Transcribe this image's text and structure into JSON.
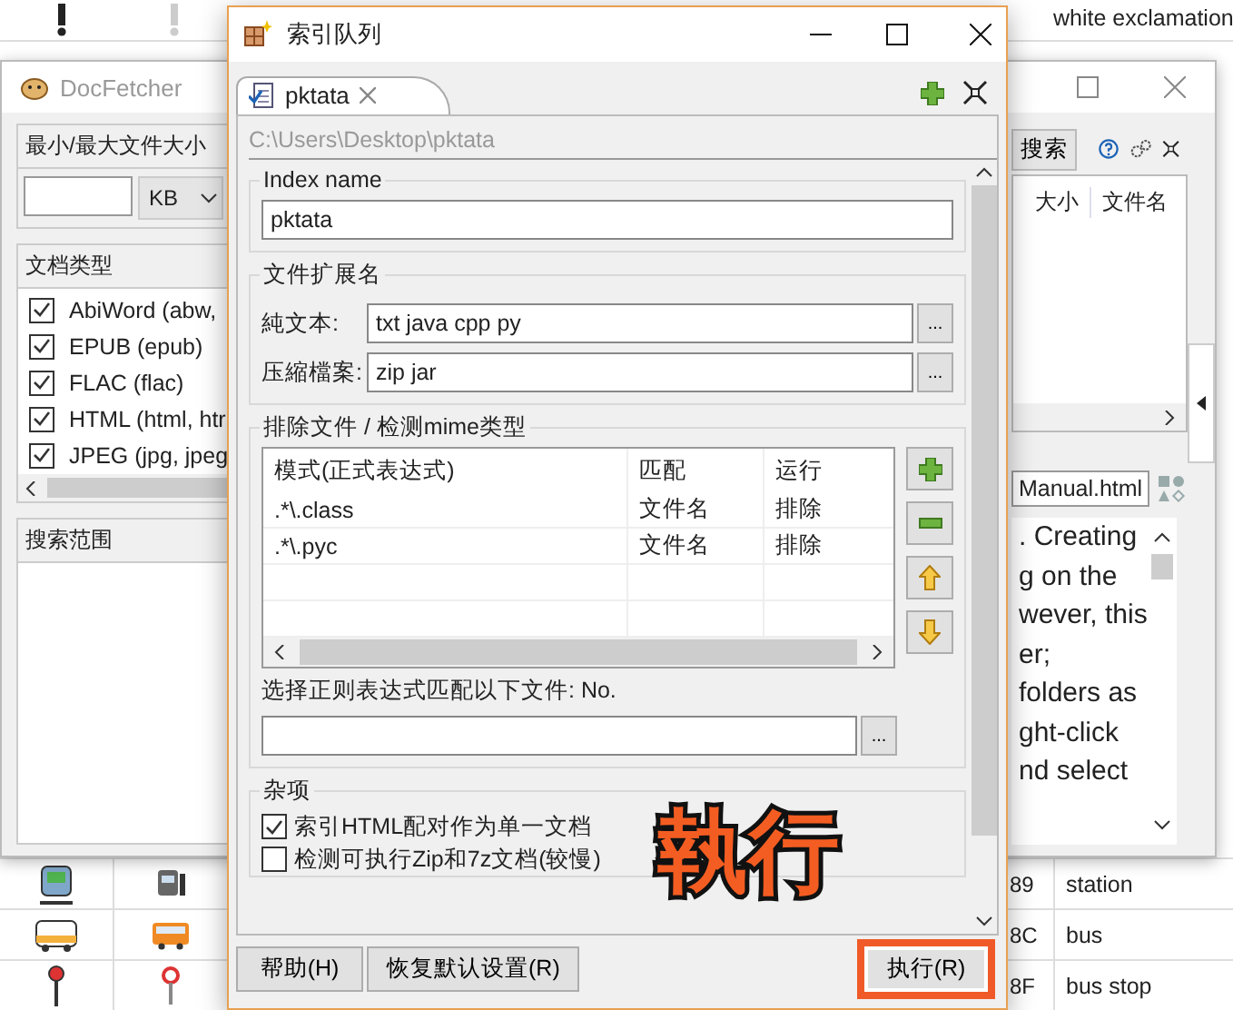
{
  "background_table": {
    "top_row": {
      "name": "white exclamation"
    },
    "rows": [
      {
        "kind": "train",
        "code": "89",
        "name": "station"
      },
      {
        "kind": "bus",
        "code": "8C",
        "name": "bus"
      },
      {
        "kind": "stop",
        "code": "8F",
        "name": "bus stop"
      }
    ]
  },
  "docfetcher": {
    "title": "DocFetcher",
    "size_filter": {
      "title": "最小/最大文件大小",
      "unit": "KB"
    },
    "file_types": {
      "title": "文档类型",
      "items": [
        {
          "label": "AbiWord (abw,",
          "checked": true
        },
        {
          "label": "EPUB (epub)",
          "checked": true
        },
        {
          "label": "FLAC (flac)",
          "checked": true
        },
        {
          "label": "HTML (html, htr",
          "checked": true
        },
        {
          "label": "JPEG (jpg, jpeg",
          "checked": true
        }
      ]
    },
    "search_scope": {
      "title": "搜索范围"
    },
    "search_button": "搜索",
    "result_columns": [
      "大小",
      "文件名"
    ],
    "preview_tab": "Manual.html",
    "preview_lines": [
      ". Creating",
      "g on the",
      "wever, this",
      "er;",
      "folders as",
      "ght-click",
      "nd select"
    ]
  },
  "dialog": {
    "title": "索引队列",
    "tab": {
      "label": "pktata",
      "selected": true
    },
    "path": "C:\\Users\\Desktop\\pktata",
    "index_name": {
      "title": "Index name",
      "value": "pktata"
    },
    "extensions": {
      "title": "文件扩展名",
      "fields": [
        {
          "label": "純文本:",
          "value": "txt java cpp py",
          "browse": "..."
        },
        {
          "label": "压縮檔案:",
          "value": "zip jar",
          "browse": "..."
        }
      ]
    },
    "exclusions": {
      "title": "排除文件 / 检测mime类型",
      "columns": [
        "模式(正式表达式)",
        "匹配",
        "运行"
      ],
      "rows": [
        [
          ".*\\.class",
          "文件名",
          "排除"
        ],
        [
          ".*\\.pyc",
          "文件名",
          "排除"
        ]
      ],
      "hint": "选择正则表达式匹配以下文件: No.",
      "browse": "..."
    },
    "misc": {
      "title": "杂项",
      "options": [
        {
          "label": "索引HTML配对作为单一文档",
          "checked": true
        },
        {
          "label": "检测可执行Zip和7z文档(较慢)",
          "checked": false
        }
      ]
    },
    "buttons": [
      {
        "label": "帮助(H)",
        "highlighted": false
      },
      {
        "label": "恢复默认设置(R)",
        "highlighted": false
      },
      {
        "label": "执行(R)",
        "highlighted": true
      }
    ]
  },
  "annotation": "執行"
}
